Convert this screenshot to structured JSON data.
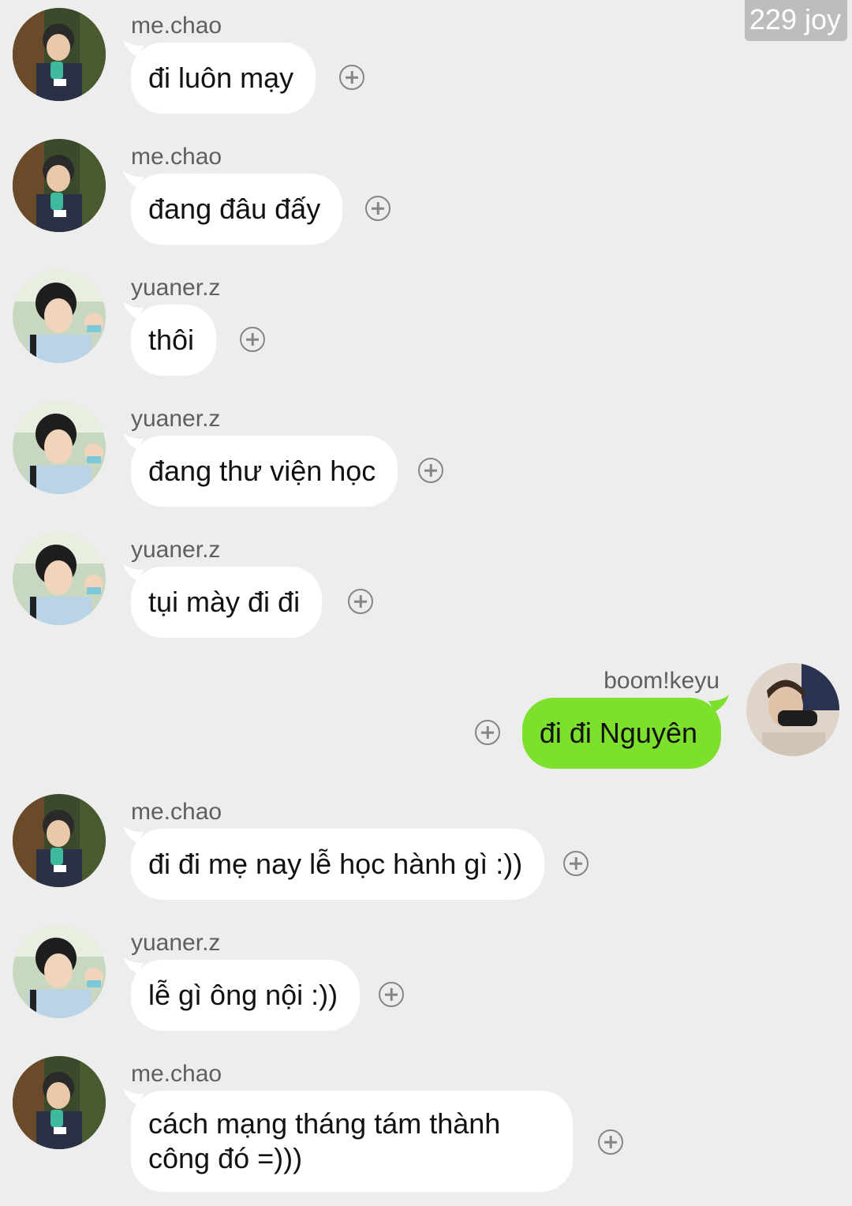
{
  "watermark": "229 joy",
  "colors": {
    "background": "#ededed",
    "bubble_incoming": "#ffffff",
    "bubble_outgoing": "#7ce02c"
  },
  "messages": [
    {
      "sender": "me.chao",
      "text": "đi luôn mạy",
      "side": "left",
      "avatar": "mechao-avatar"
    },
    {
      "sender": "me.chao",
      "text": "đang đâu đấy",
      "side": "left",
      "avatar": "mechao-avatar"
    },
    {
      "sender": "yuaner.z",
      "text": "thôi",
      "side": "left",
      "avatar": "yuaner-avatar"
    },
    {
      "sender": "yuaner.z",
      "text": "đang thư viện học",
      "side": "left",
      "avatar": "yuaner-avatar"
    },
    {
      "sender": "yuaner.z",
      "text": "tụi mày đi đi",
      "side": "left",
      "avatar": "yuaner-avatar"
    },
    {
      "sender": "boom!keyu",
      "text": "đi đi Nguyên",
      "side": "right",
      "avatar": "keyu-avatar"
    },
    {
      "sender": "me.chao",
      "text": "đi đi mẹ nay lễ học hành gì :))",
      "side": "left",
      "avatar": "mechao-avatar"
    },
    {
      "sender": "yuaner.z",
      "text": "lễ gì ông nội :))",
      "side": "left",
      "avatar": "yuaner-avatar"
    },
    {
      "sender": "me.chao",
      "text": "cách mạng tháng tám thành công đó =)))",
      "side": "left",
      "avatar": "mechao-avatar"
    }
  ]
}
